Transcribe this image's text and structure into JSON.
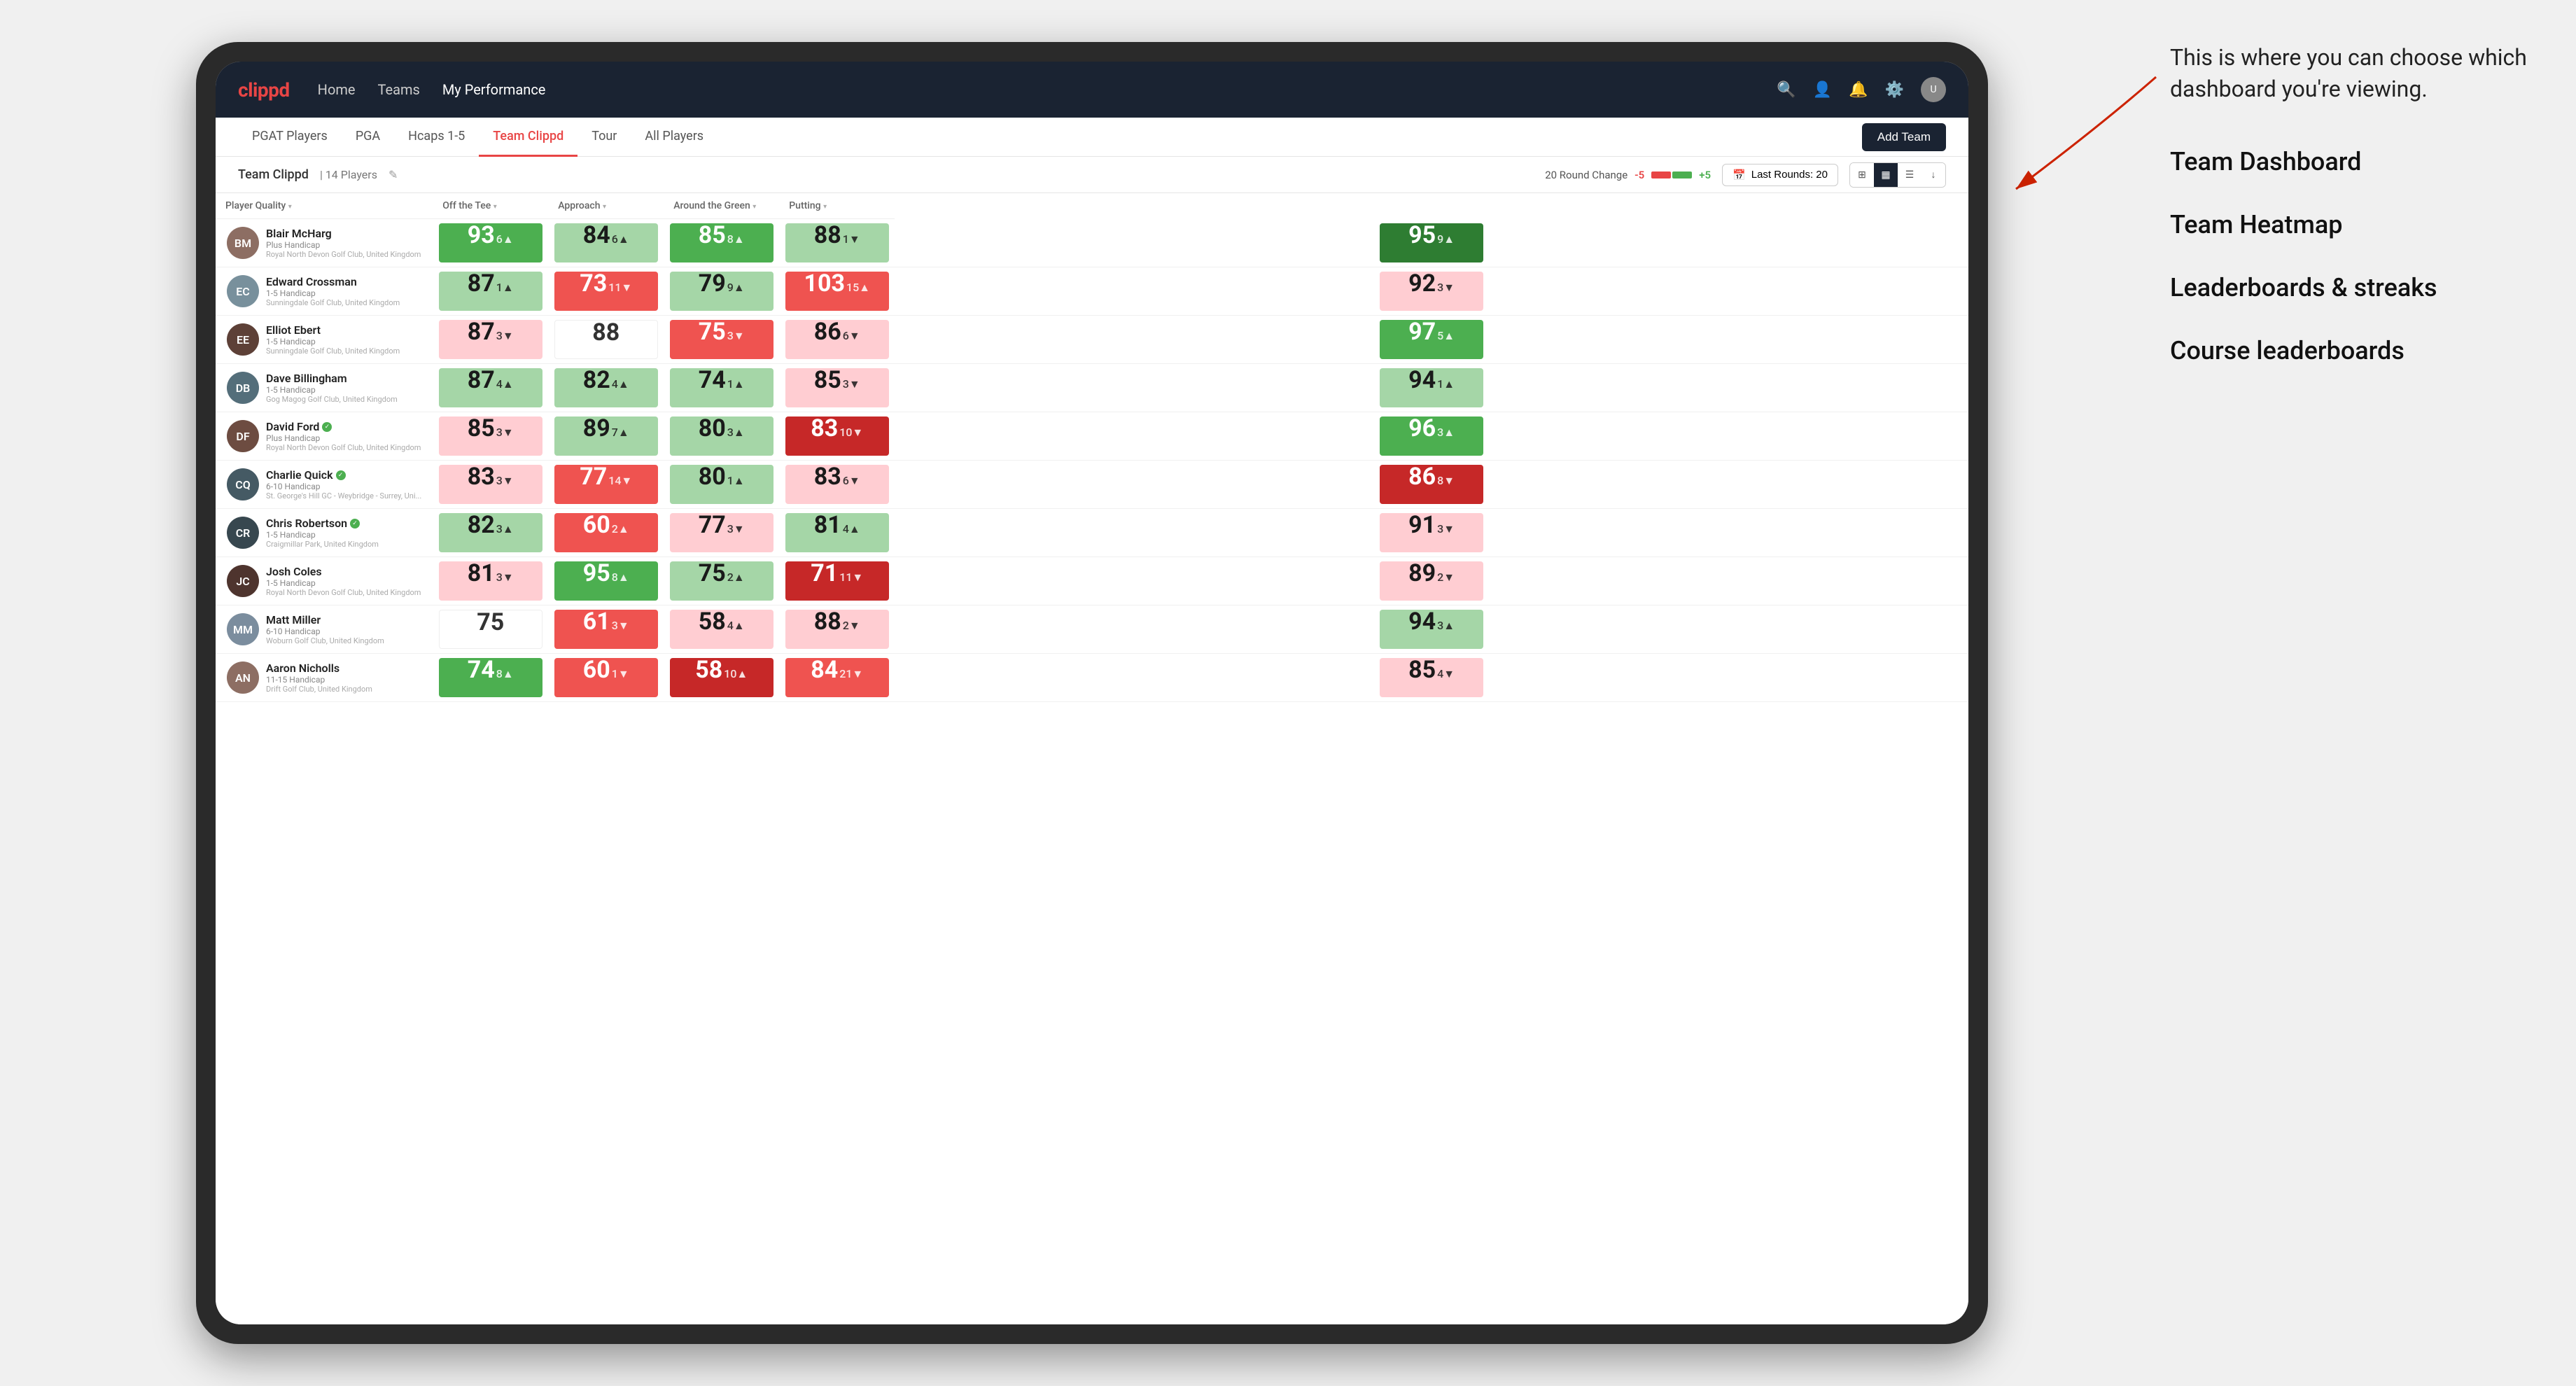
{
  "annotation": {
    "intro_text": "This is where you can choose which dashboard you're viewing.",
    "items": [
      {
        "label": "Team Dashboard"
      },
      {
        "label": "Team Heatmap"
      },
      {
        "label": "Leaderboards & streaks"
      },
      {
        "label": "Course leaderboards"
      }
    ]
  },
  "navbar": {
    "logo": "clippd",
    "nav_items": [
      {
        "label": "Home",
        "active": false
      },
      {
        "label": "Teams",
        "active": false
      },
      {
        "label": "My Performance",
        "active": true
      }
    ],
    "icons": [
      "search",
      "person",
      "notifications",
      "settings",
      "avatar"
    ]
  },
  "subnav": {
    "tabs": [
      {
        "label": "PGAT Players",
        "active": false
      },
      {
        "label": "PGA",
        "active": false
      },
      {
        "label": "Hcaps 1-5",
        "active": false
      },
      {
        "label": "Team Clippd",
        "active": true
      },
      {
        "label": "Tour",
        "active": false
      },
      {
        "label": "All Players",
        "active": false
      }
    ],
    "add_button_label": "Add Team"
  },
  "team_header": {
    "title": "Team Clippd",
    "separator": "|",
    "count_label": "14 Players",
    "round_change_label": "20 Round Change",
    "change_minus": "-5",
    "change_plus": "+5",
    "last_rounds_label": "Last Rounds:",
    "last_rounds_value": "20"
  },
  "table": {
    "columns": [
      {
        "label": "Player Quality",
        "sortable": true
      },
      {
        "label": "Off the Tee",
        "sortable": true
      },
      {
        "label": "Approach",
        "sortable": true
      },
      {
        "label": "Around the Green",
        "sortable": true
      },
      {
        "label": "Putting",
        "sortable": true
      }
    ],
    "players": [
      {
        "name": "Blair McHarg",
        "handicap": "Plus Handicap",
        "club": "Royal North Devon Golf Club, United Kingdom",
        "verified": false,
        "avatar_color": "#8d6e63",
        "scores": [
          {
            "value": "93",
            "delta": "6",
            "dir": "up",
            "bg": "green-mid"
          },
          {
            "value": "84",
            "delta": "6",
            "dir": "up",
            "bg": "green-light"
          },
          {
            "value": "85",
            "delta": "8",
            "dir": "up",
            "bg": "green-mid"
          },
          {
            "value": "88",
            "delta": "1",
            "dir": "down",
            "bg": "green-light"
          },
          {
            "value": "95",
            "delta": "9",
            "dir": "up",
            "bg": "green-dark"
          }
        ]
      },
      {
        "name": "Edward Crossman",
        "handicap": "1-5 Handicap",
        "club": "Sunningdale Golf Club, United Kingdom",
        "verified": false,
        "avatar_color": "#78909c",
        "scores": [
          {
            "value": "87",
            "delta": "1",
            "dir": "up",
            "bg": "green-light"
          },
          {
            "value": "73",
            "delta": "11",
            "dir": "down",
            "bg": "red-mid"
          },
          {
            "value": "79",
            "delta": "9",
            "dir": "up",
            "bg": "green-light"
          },
          {
            "value": "103",
            "delta": "15",
            "dir": "up",
            "bg": "red-mid"
          },
          {
            "value": "92",
            "delta": "3",
            "dir": "down",
            "bg": "red-light"
          }
        ]
      },
      {
        "name": "Elliot Ebert",
        "handicap": "1-5 Handicap",
        "club": "Sunningdale Golf Club, United Kingdom",
        "verified": false,
        "avatar_color": "#5d4037",
        "scores": [
          {
            "value": "87",
            "delta": "3",
            "dir": "down",
            "bg": "red-light"
          },
          {
            "value": "88",
            "delta": "",
            "dir": "",
            "bg": "white"
          },
          {
            "value": "75",
            "delta": "3",
            "dir": "down",
            "bg": "red-mid"
          },
          {
            "value": "86",
            "delta": "6",
            "dir": "down",
            "bg": "red-light"
          },
          {
            "value": "97",
            "delta": "5",
            "dir": "up",
            "bg": "green-mid"
          }
        ]
      },
      {
        "name": "Dave Billingham",
        "handicap": "1-5 Handicap",
        "club": "Gog Magog Golf Club, United Kingdom",
        "verified": false,
        "avatar_color": "#546e7a",
        "scores": [
          {
            "value": "87",
            "delta": "4",
            "dir": "up",
            "bg": "green-light"
          },
          {
            "value": "82",
            "delta": "4",
            "dir": "up",
            "bg": "green-light"
          },
          {
            "value": "74",
            "delta": "1",
            "dir": "up",
            "bg": "green-light"
          },
          {
            "value": "85",
            "delta": "3",
            "dir": "down",
            "bg": "red-light"
          },
          {
            "value": "94",
            "delta": "1",
            "dir": "up",
            "bg": "green-light"
          }
        ]
      },
      {
        "name": "David Ford",
        "handicap": "Plus Handicap",
        "club": "Royal North Devon Golf Club, United Kingdom",
        "verified": true,
        "avatar_color": "#6d4c41",
        "scores": [
          {
            "value": "85",
            "delta": "3",
            "dir": "down",
            "bg": "red-light"
          },
          {
            "value": "89",
            "delta": "7",
            "dir": "up",
            "bg": "green-light"
          },
          {
            "value": "80",
            "delta": "3",
            "dir": "up",
            "bg": "green-light"
          },
          {
            "value": "83",
            "delta": "10",
            "dir": "down",
            "bg": "red-dark"
          },
          {
            "value": "96",
            "delta": "3",
            "dir": "up",
            "bg": "green-mid"
          }
        ]
      },
      {
        "name": "Charlie Quick",
        "handicap": "6-10 Handicap",
        "club": "St. George's Hill GC - Weybridge - Surrey, Uni...",
        "verified": true,
        "avatar_color": "#455a64",
        "scores": [
          {
            "value": "83",
            "delta": "3",
            "dir": "down",
            "bg": "red-light"
          },
          {
            "value": "77",
            "delta": "14",
            "dir": "down",
            "bg": "red-mid"
          },
          {
            "value": "80",
            "delta": "1",
            "dir": "up",
            "bg": "green-light"
          },
          {
            "value": "83",
            "delta": "6",
            "dir": "down",
            "bg": "red-light"
          },
          {
            "value": "86",
            "delta": "8",
            "dir": "down",
            "bg": "red-dark"
          }
        ]
      },
      {
        "name": "Chris Robertson",
        "handicap": "1-5 Handicap",
        "club": "Craigmillar Park, United Kingdom",
        "verified": true,
        "avatar_color": "#37474f",
        "scores": [
          {
            "value": "82",
            "delta": "3",
            "dir": "up",
            "bg": "green-light"
          },
          {
            "value": "60",
            "delta": "2",
            "dir": "up",
            "bg": "red-mid"
          },
          {
            "value": "77",
            "delta": "3",
            "dir": "down",
            "bg": "red-light"
          },
          {
            "value": "81",
            "delta": "4",
            "dir": "up",
            "bg": "green-light"
          },
          {
            "value": "91",
            "delta": "3",
            "dir": "down",
            "bg": "red-light"
          }
        ]
      },
      {
        "name": "Josh Coles",
        "handicap": "1-5 Handicap",
        "club": "Royal North Devon Golf Club, United Kingdom",
        "verified": false,
        "avatar_color": "#4e342e",
        "scores": [
          {
            "value": "81",
            "delta": "3",
            "dir": "down",
            "bg": "red-light"
          },
          {
            "value": "95",
            "delta": "8",
            "dir": "up",
            "bg": "green-mid"
          },
          {
            "value": "75",
            "delta": "2",
            "dir": "up",
            "bg": "green-light"
          },
          {
            "value": "71",
            "delta": "11",
            "dir": "down",
            "bg": "red-dark"
          },
          {
            "value": "89",
            "delta": "2",
            "dir": "down",
            "bg": "red-light"
          }
        ]
      },
      {
        "name": "Matt Miller",
        "handicap": "6-10 Handicap",
        "club": "Woburn Golf Club, United Kingdom",
        "verified": false,
        "avatar_color": "#7b8d9e",
        "scores": [
          {
            "value": "75",
            "delta": "",
            "dir": "",
            "bg": "white"
          },
          {
            "value": "61",
            "delta": "3",
            "dir": "down",
            "bg": "red-mid"
          },
          {
            "value": "58",
            "delta": "4",
            "dir": "up",
            "bg": "red-light"
          },
          {
            "value": "88",
            "delta": "2",
            "dir": "down",
            "bg": "red-light"
          },
          {
            "value": "94",
            "delta": "3",
            "dir": "up",
            "bg": "green-light"
          }
        ]
      },
      {
        "name": "Aaron Nicholls",
        "handicap": "11-15 Handicap",
        "club": "Drift Golf Club, United Kingdom",
        "verified": false,
        "avatar_color": "#8d6e63",
        "scores": [
          {
            "value": "74",
            "delta": "8",
            "dir": "up",
            "bg": "green-mid"
          },
          {
            "value": "60",
            "delta": "1",
            "dir": "down",
            "bg": "red-mid"
          },
          {
            "value": "58",
            "delta": "10",
            "dir": "up",
            "bg": "red-dark"
          },
          {
            "value": "84",
            "delta": "21",
            "dir": "down",
            "bg": "red-mid"
          },
          {
            "value": "85",
            "delta": "4",
            "dir": "down",
            "bg": "red-light"
          }
        ]
      }
    ]
  }
}
